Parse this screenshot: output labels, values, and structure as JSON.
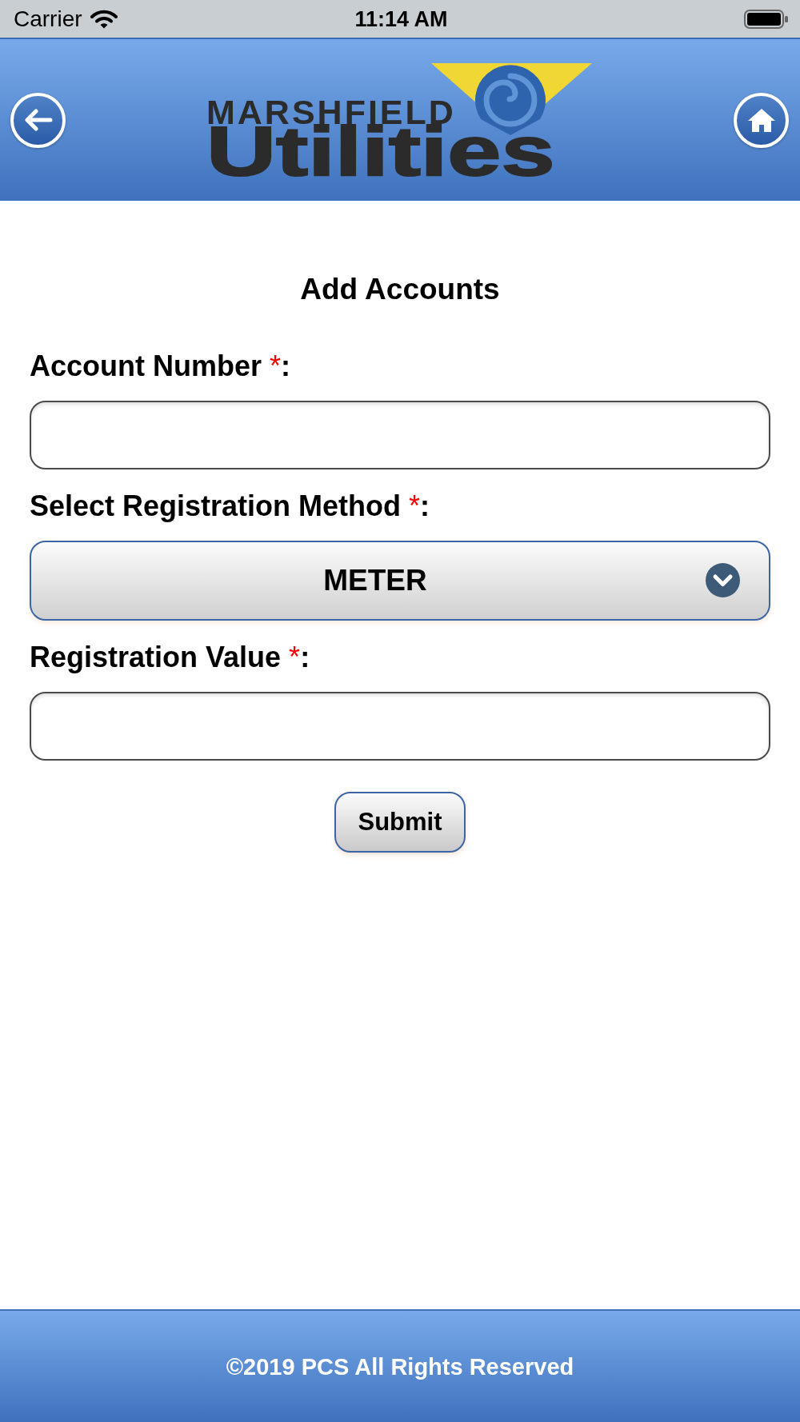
{
  "status_bar": {
    "carrier": "Carrier",
    "time": "11:14 AM"
  },
  "header": {
    "logo": {
      "line_1": "MARSHFIELD",
      "line_2": "Utilities"
    }
  },
  "form": {
    "title": "Add Accounts",
    "fields": [
      {
        "kind": "text",
        "label": "Account Number",
        "required_mark": "*",
        "label_suffix": ":"
      },
      {
        "kind": "select",
        "label": "Select Registration Method",
        "required_mark": "*",
        "label_suffix": ":",
        "value": "METER"
      },
      {
        "kind": "text",
        "label": "Registration Value",
        "required_mark": "*",
        "label_suffix": ":"
      }
    ],
    "submit_button": "Submit"
  },
  "footer": {
    "text": "©2019 PCS All Rights Reserved"
  }
}
